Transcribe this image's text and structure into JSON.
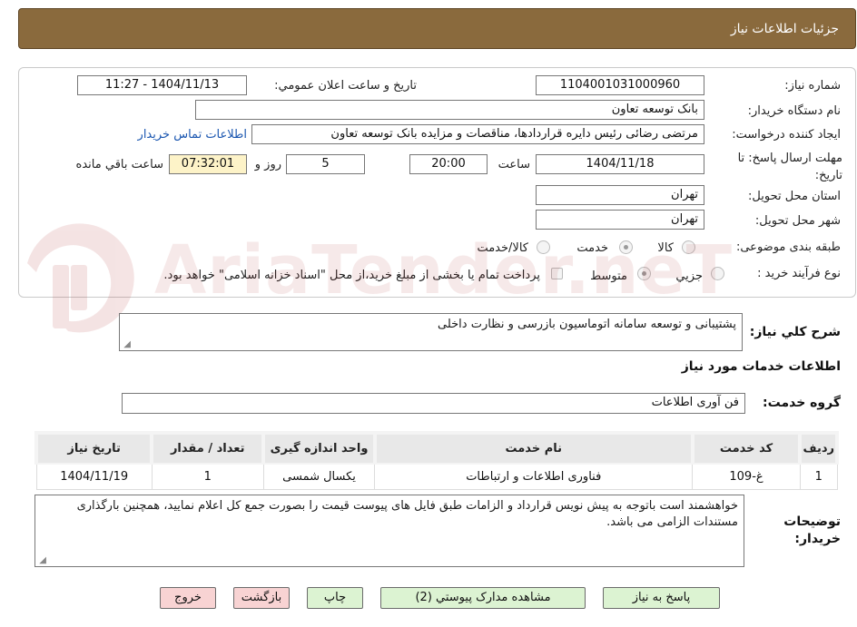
{
  "header": {
    "title": "جزئیات اطلاعات نیاز"
  },
  "form": {
    "need_number_label": "شماره نیاز:",
    "need_number": "1104001031000960",
    "announce_label": "تاریخ و ساعت اعلان عمومي:",
    "announce_value": "1404/11/13 - 11:27",
    "buyer_org_label": "نام دستگاه خريدار:",
    "buyer_org": "بانک توسعه تعاون",
    "requester_label": "ایجاد کننده درخواست:",
    "requester": "مرتضی رضائی رئیس دایره قراردادها، مناقصات و مزایده بانک توسعه تعاون",
    "contact_link": "اطلاعات تماس خریدار",
    "deadline_label": "مهلت ارسال پاسخ: تا تاریخ:",
    "deadline_date": "1404/11/18",
    "time_label": "ساعت",
    "deadline_time": "20:00",
    "days_value": "5",
    "days_label": "روز و",
    "remaining_time": "07:32:01",
    "remaining_label": "ساعت باقي مانده",
    "province_label": "استان محل تحویل:",
    "province": "تهران",
    "city_label": "شهر محل تحویل:",
    "city": "تهران",
    "category_label": "طبقه بندی موضوعی:",
    "category_options": [
      "کالا",
      "خدمت",
      "کالا/خدمت"
    ],
    "category_selected": "خدمت",
    "process_label": "نوع فرآیند خرید :",
    "process_options": [
      "جزيي",
      "متوسط"
    ],
    "process_selected": "متوسط",
    "payment_note": "پرداخت تمام یا بخشی از مبلغ خرید،از محل \"اسناد خزانه اسلامی\" خواهد بود."
  },
  "summary": {
    "label": "شرح کلي نياز:",
    "text": "پشتیبانی و توسعه سامانه اتوماسیون بازرسی و نظارت داخلی"
  },
  "services": {
    "section_title": "اطلاعات خدمات مورد نیاز",
    "group_label": "گروه خدمت:",
    "group_value": "فن آوری اطلاعات",
    "table": {
      "headers": [
        "رديف",
        "کد خدمت",
        "نام خدمت",
        "واحد اندازه گیری",
        "تعداد / مقدار",
        "تاریخ نیاز"
      ],
      "rows": [
        [
          "1",
          "غ-109",
          "فناوری اطلاعات و ارتباطات",
          "یکسال شمسی",
          "1",
          "1404/11/19"
        ]
      ]
    }
  },
  "buyer_notes": {
    "label": "توضيحات خريدار:",
    "text": "خواهشمند است باتوجه به پیش نویس قرارداد و الزامات طبق فایل های پیوست قیمت را بصورت جمع کل اعلام نمایید، همچنین بارگذاری مستندات الزامی می باشد."
  },
  "buttons": {
    "reply": "پاسخ به نیاز",
    "view_docs": "مشاهده مدارک پیوستي (2)",
    "print": "چاپ",
    "back": "بازگشت",
    "exit": "خروج"
  },
  "watermark": {
    "text": "AriaTender.neT"
  },
  "colors": {
    "header_bg": "#8a6a3d",
    "button_green": "#dcf3d2",
    "button_red": "#f8d3d3",
    "remaining_bg": "#fdf3c8",
    "link": "#1a56b0"
  }
}
